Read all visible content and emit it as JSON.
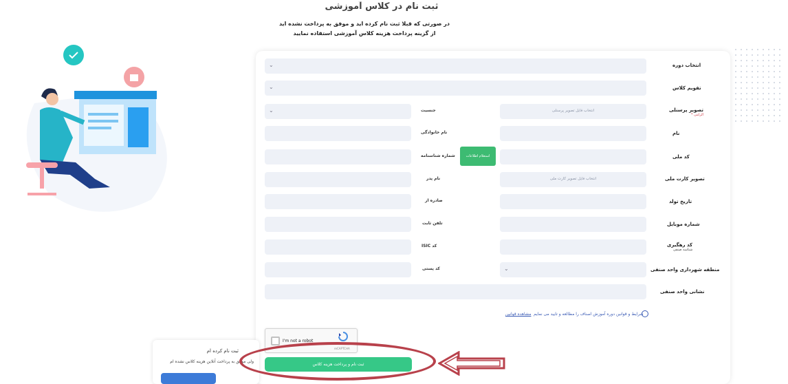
{
  "header": {
    "title": "ثبت نام در کلاس آموزشی",
    "notice_line1": "در صورتی که قبلا ثبت نام کرده اید و موفق به پرداخت نشده اید",
    "notice_line2": "از گزینه پرداخت هزینه کلاس آموزشی استفاده نمایید"
  },
  "form": {
    "rows": {
      "course_label": "انتخاب دوره",
      "calendar_label": "تقویم کلاس",
      "photo_label": "تصویر پرسنلی",
      "photo_required": "الزامی *",
      "photo_placeholder": "انتخاب فایل تصویر پرسنلی",
      "gender_label": "جنسیت",
      "name_label": "نام",
      "family_label": "نام خانوادگی",
      "national_code_label": "کد ملی",
      "inquiry_button": "استعلام اطلاعات",
      "id_number_label": "شماره شناسنامه",
      "national_card_label": "تصویر کارت ملی",
      "national_card_placeholder": "انتخاب فایل تصویر کارت ملی",
      "father_label": "نام پدر",
      "birth_date_label": "تاریخ تولد",
      "issued_label": "صادره از",
      "mobile_label": "شماره موبایل",
      "phone_label": "تلفن ثابت",
      "tracking_label": "کد رهگیری",
      "tracking_sub": "شناسه صنفی",
      "isic_label": "کد ISIC",
      "district_label": "منطقه شهرداری واحد صنفی",
      "postal_label": "کد پستی",
      "address_label": "نشانی واحد صنفی"
    },
    "terms_text": "شرایط و قوانین دوره آموزش اصناف را مطالعه و تایید می نمایم",
    "terms_link": "مشاهده قوانین",
    "captcha_text": "I'm not a robot",
    "captcha_brand": "reCAPTCHA",
    "submit_label": "ثبت نام و پرداخت هزینه کلاس"
  },
  "side_box": {
    "title": "ثبت نام کرده ام",
    "subtitle": "ولی موفق به پرداخت آنلاین هزینه کلاس نشده ام"
  },
  "colors": {
    "accent_green": "#36c887",
    "annotation_red": "#b8414b",
    "field_bg": "#eef1f7"
  }
}
